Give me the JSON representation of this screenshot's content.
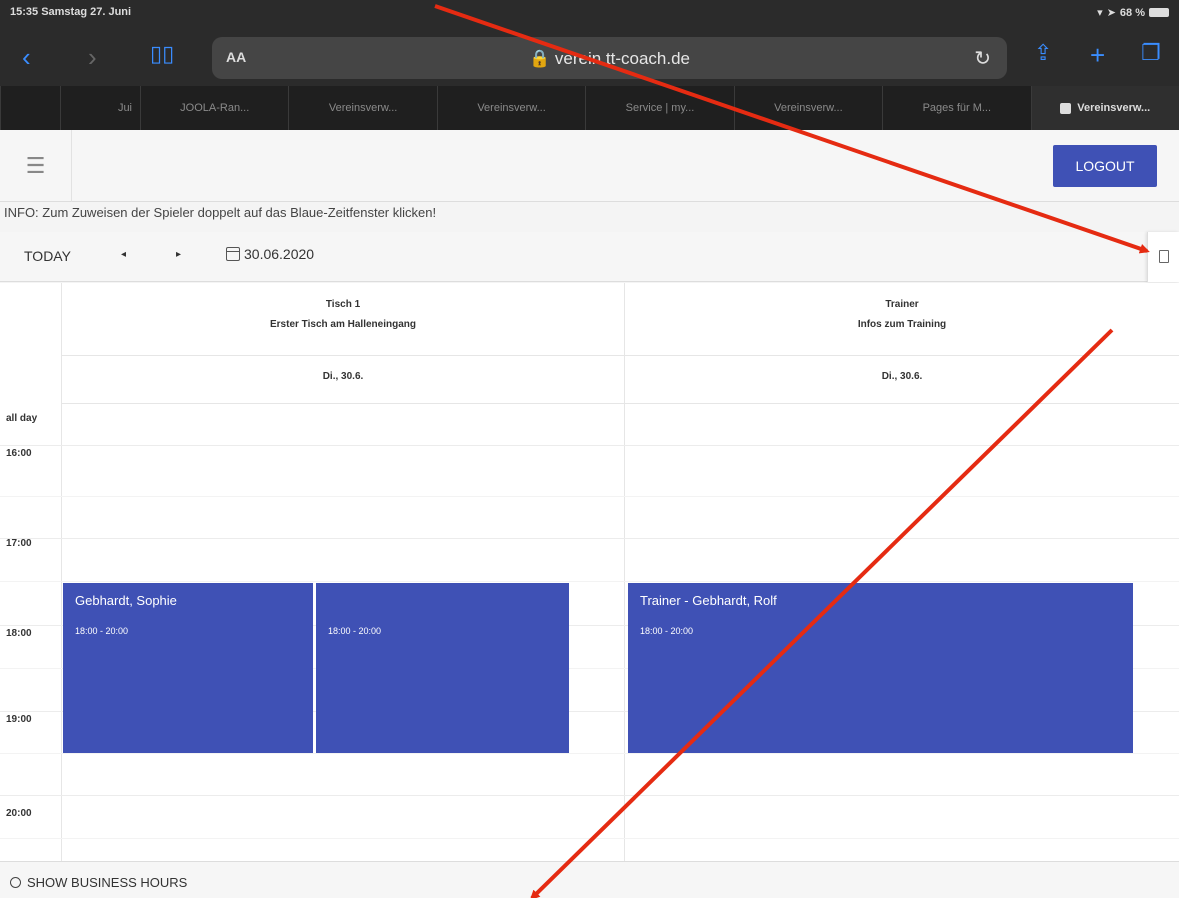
{
  "status": {
    "time_date": "15:35  Samstag 27. Juni",
    "battery": "68 %"
  },
  "browser": {
    "aa_label": "AA",
    "url": "verein.tt-coach.de",
    "tabs": [
      {
        "label": "Jui"
      },
      {
        "label": "JOOLA-Ran..."
      },
      {
        "label": "Vereinsverw..."
      },
      {
        "label": "Vereinsverw..."
      },
      {
        "label": "Service | my..."
      },
      {
        "label": "Vereinsverw..."
      },
      {
        "label": "Pages für M..."
      },
      {
        "label": "Vereinsverw..."
      }
    ]
  },
  "header": {
    "logout_label": "LOGOUT"
  },
  "info_text": "INFO: Zum Zuweisen der Spieler doppelt auf das Blaue-Zeitfenster klicken!",
  "calendar_toolbar": {
    "today_label": "TODAY",
    "prev_label": "◂",
    "next_label": "▸",
    "date": "30.06.2020"
  },
  "calendar": {
    "resources": [
      {
        "name": "Tisch 1",
        "subtitle": "Erster Tisch am Halleneingang",
        "day": "Di., 30.6."
      },
      {
        "name": "Trainer",
        "subtitle": "Infos zum Training",
        "day": "Di., 30.6."
      }
    ],
    "all_day_label": "all day",
    "hours": [
      "16:00",
      "17:00",
      "18:00",
      "19:00",
      "20:00"
    ],
    "events": [
      {
        "title": "Gebhardt, Sophie",
        "time": "18:00 - 20:00"
      },
      {
        "title": "",
        "time": "18:00 - 20:00"
      },
      {
        "title": "Trainer - Gebhardt, Rolf",
        "time": "18:00 - 20:00"
      }
    ]
  },
  "footer": {
    "business_hours_label": "SHOW BUSINESS HOURS"
  },
  "colors": {
    "event_blue": "#3f51b5",
    "annotation_red": "#e52b12",
    "safari_blue": "#3a8dff"
  }
}
